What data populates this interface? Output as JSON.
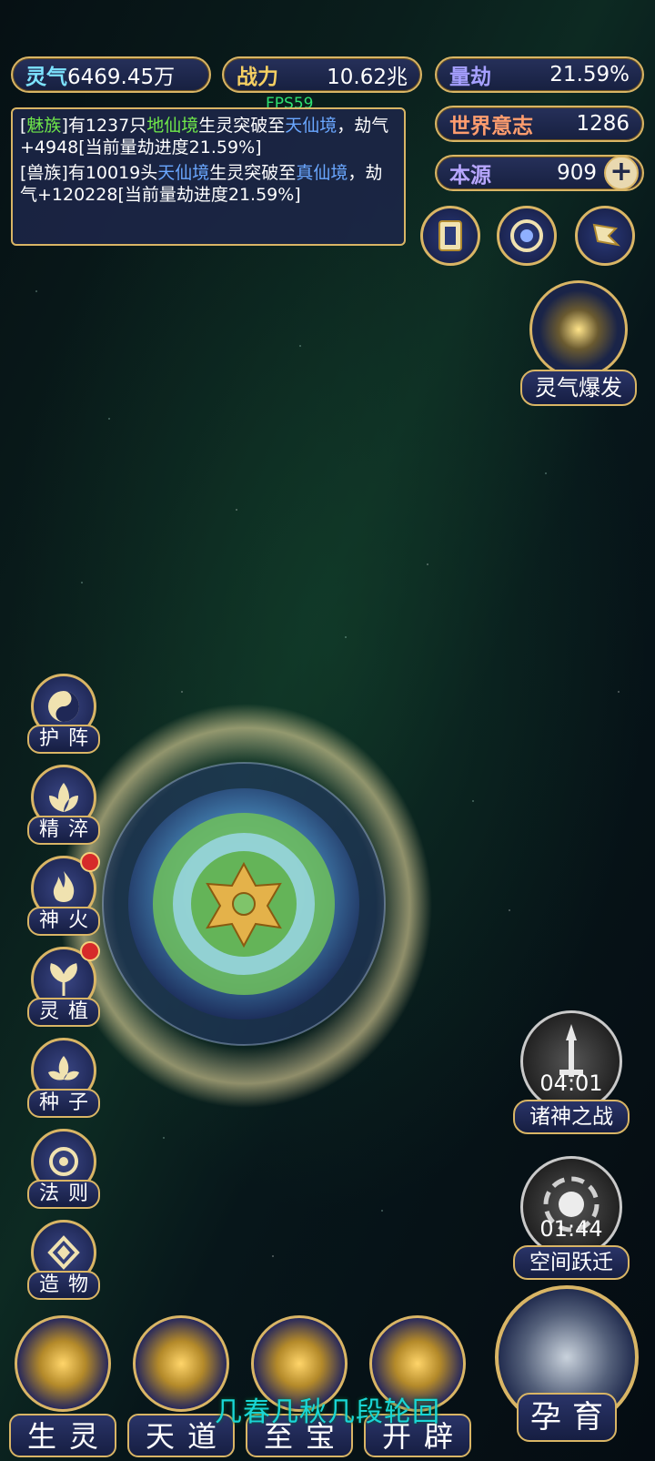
{
  "stats": {
    "lingqi": {
      "label": "灵气",
      "value": "6469.45万"
    },
    "zhanli": {
      "label": "战力",
      "value": "10.62兆"
    },
    "liangjie": {
      "label": "量劫",
      "value": "21.59%"
    },
    "shijie": {
      "label": "世界意志",
      "value": "1286"
    },
    "benyuan": {
      "label": "本源",
      "value": "909",
      "plus": "+"
    }
  },
  "fps": "FPS59",
  "log": [
    {
      "pre": "[",
      "race": "魅族",
      "mid": "]有1237只",
      "realm": "地仙境",
      "mid2": "生灵突破至",
      "target": "天仙境",
      "post": "，劫气+4948[当前量劫进度21.59%]"
    },
    {
      "pre": "[兽族]有10019头",
      "realm": "天仙境",
      "mid2": "生灵突破至",
      "target": "真仙境",
      "post": "，劫气+120228[当前量劫进度21.59%]"
    }
  ],
  "burst": {
    "label": "灵气爆发"
  },
  "side_buttons": [
    {
      "label": "护阵",
      "icon": "yin-yang-icon"
    },
    {
      "label": "精淬",
      "icon": "lotus-icon"
    },
    {
      "label": "神火",
      "icon": "flame-icon",
      "badge": true
    },
    {
      "label": "灵植",
      "icon": "plant-icon",
      "badge": true
    },
    {
      "label": "种子",
      "icon": "seed-icon"
    },
    {
      "label": "法则",
      "icon": "rune-icon"
    },
    {
      "label": "造物",
      "icon": "diamond-icon"
    }
  ],
  "events": [
    {
      "label": "诸神之战",
      "timer": "04:01",
      "icon": "sword-icon"
    },
    {
      "label": "空间跃迁",
      "timer": "01:44",
      "icon": "vortex-icon"
    }
  ],
  "bottom_nav": [
    {
      "label": "生灵",
      "icon": "phoenix-icon"
    },
    {
      "label": "天道",
      "icon": "cloud-icon"
    },
    {
      "label": "至宝",
      "icon": "treasure-icon"
    },
    {
      "label": "开辟",
      "icon": "axe-icon"
    }
  ],
  "motto": "几春几秋几段轮回",
  "yunyu": {
    "label": "孕育"
  }
}
